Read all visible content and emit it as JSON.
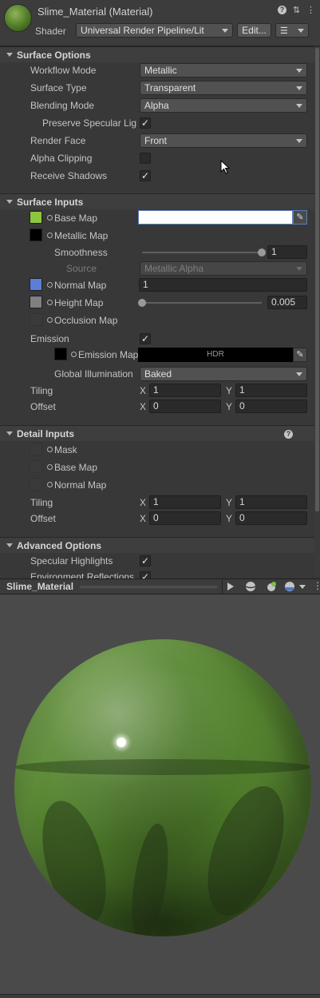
{
  "header": {
    "title": "Slime_Material (Material)",
    "shader_label": "Shader",
    "shader_value": "Universal Render Pipeline/Lit",
    "edit_button": "Edit..."
  },
  "surface_options": {
    "title": "Surface Options",
    "workflow_mode_label": "Workflow Mode",
    "workflow_mode_value": "Metallic",
    "surface_type_label": "Surface Type",
    "surface_type_value": "Transparent",
    "blending_mode_label": "Blending Mode",
    "blending_mode_value": "Alpha",
    "preserve_specular_label": "Preserve Specular Lig",
    "render_face_label": "Render Face",
    "render_face_value": "Front",
    "alpha_clipping_label": "Alpha Clipping",
    "receive_shadows_label": "Receive Shadows"
  },
  "surface_inputs": {
    "title": "Surface Inputs",
    "base_map_label": "Base Map",
    "metallic_map_label": "Metallic Map",
    "smoothness_label": "Smoothness",
    "smoothness_value": "1",
    "smoothness_level": 1.0,
    "source_label": "Source",
    "source_value": "Metallic Alpha",
    "normal_map_label": "Normal Map",
    "normal_map_value": "1",
    "height_map_label": "Height Map",
    "height_map_value": "0.005",
    "height_level": 0.0,
    "occlusion_map_label": "Occlusion Map",
    "emission_label": "Emission",
    "emission_map_label": "Emission Map",
    "hdr_label": "HDR",
    "gi_label": "Global Illumination",
    "gi_value": "Baked",
    "tiling_label": "Tiling",
    "tiling_x": "1",
    "tiling_y": "1",
    "offset_label": "Offset",
    "offset_x": "0",
    "offset_y": "0",
    "x_label": "X",
    "y_label": "Y"
  },
  "detail_inputs": {
    "title": "Detail Inputs",
    "mask_label": "Mask",
    "base_map_label": "Base Map",
    "normal_map_label": "Normal Map",
    "tiling_label": "Tiling",
    "tiling_x": "1",
    "tiling_y": "1",
    "offset_label": "Offset",
    "offset_x": "0",
    "offset_y": "0",
    "x_label": "X",
    "y_label": "Y"
  },
  "advanced_options": {
    "title": "Advanced Options",
    "specular_highlights_label": "Specular Highlights",
    "environment_reflections_label": "Environment Reflections"
  },
  "preview": {
    "title": "Slime_Material"
  },
  "colors": {
    "base_map": "#8cc63f",
    "metallic_map": "#000000",
    "normal_map": "#5b7fd6",
    "height_map": "#808080",
    "emission_map": "#000000"
  }
}
